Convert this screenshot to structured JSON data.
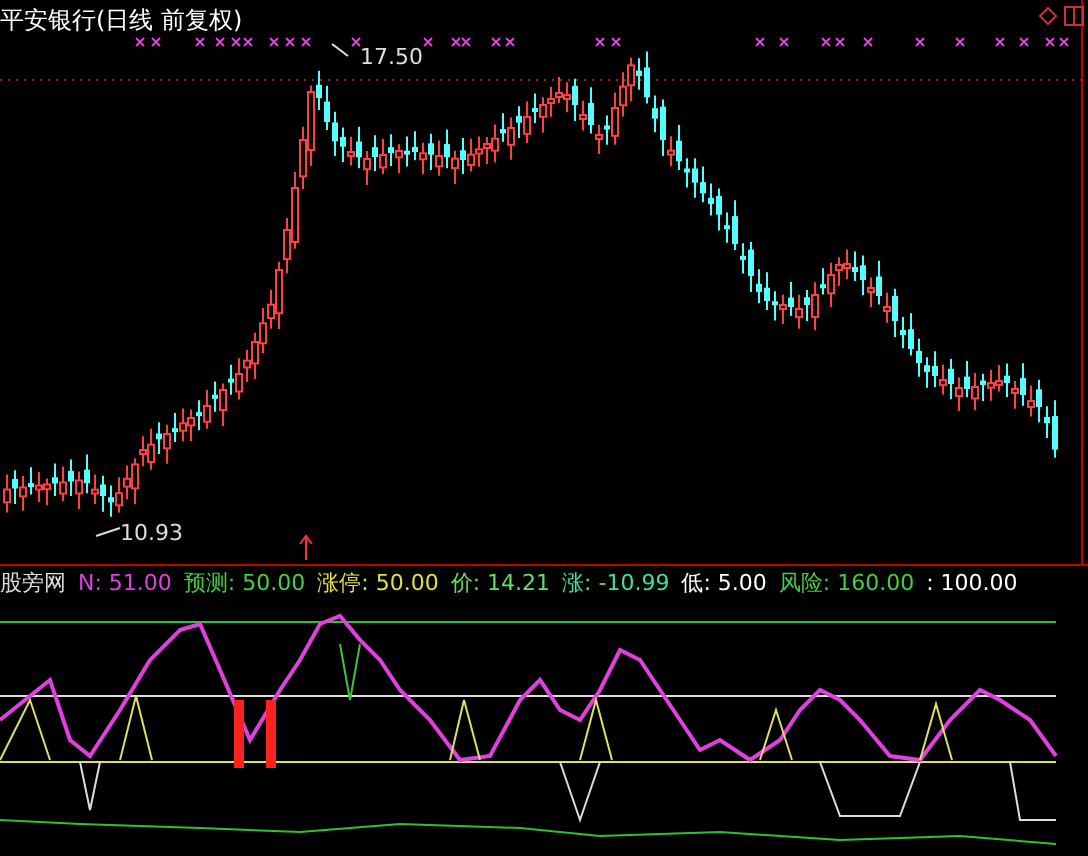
{
  "main_chart": {
    "title": "平安银行(日线 前复权)",
    "high_label": "17.50",
    "low_label": "10.93"
  },
  "indicator": {
    "name": "股旁网",
    "values": [
      {
        "text": "N: 51.00",
        "color": "#e040e0"
      },
      {
        "text": "预测: 50.00",
        "color": "#40d040"
      },
      {
        "text": "涨停: 50.00",
        "color": "#e0e040"
      },
      {
        "text": "价: 14.21",
        "color": "#60e060"
      },
      {
        "text": "涨: -10.99",
        "color": "#40e0a0"
      },
      {
        "text": "低: 5.00",
        "color": "#ffffff"
      },
      {
        "text": "风险: 160.00",
        "color": "#40d040"
      },
      {
        "text": ": 100.00",
        "color": "#ffffff"
      }
    ]
  }
}
